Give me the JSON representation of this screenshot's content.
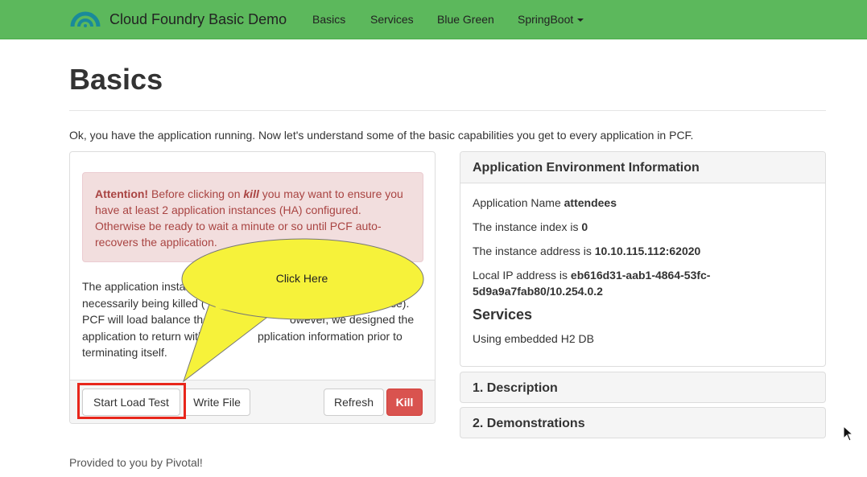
{
  "navbar": {
    "brand": "Cloud Foundry Basic Demo",
    "links": [
      "Basics",
      "Services",
      "Blue Green",
      "SpringBoot"
    ],
    "color": "#5cb85c"
  },
  "page": {
    "title": "Basics",
    "intro": "Ok, you have the application running. Now let's understand some of the basic capabilities you get to every application in PCF."
  },
  "alert": {
    "strong": "Attention!",
    "pre": " Before clicking on ",
    "em": "kill",
    "post": " you may want to ensure you have at least 2 application instances (HA) configured. Otherwise be ready to wait a minute or so until PCF auto-recovers the application."
  },
  "body_text": {
    "line1": "The application insta",
    "line2": "necessarily being killed (",
    "line2b": "se).",
    "line3": "PCF will load balance the reque",
    "line3b": "owever, we designed the",
    "line4": "application to return with the",
    "line4b": "pplication information prior to",
    "line5": "terminating itself."
  },
  "buttons": {
    "start_load": "Start Load Test",
    "write_file": "Write File",
    "refresh": "Refresh",
    "kill": "Kill"
  },
  "callout": {
    "text": "Click Here"
  },
  "env": {
    "heading": "Application Environment Information",
    "app_name_label": "Application Name ",
    "app_name": "attendees",
    "index_label": "The instance index is ",
    "index": "0",
    "address_label": "The instance address is ",
    "address": "10.10.115.112:62020",
    "local_ip_label": "Local IP address is ",
    "local_ip_1": "eb616d31-aab1-4864-53fc-",
    "local_ip_2": "5d9a9a7fab80/10.254.0.2",
    "services_title": "Services",
    "services_text": "Using embedded H2 DB"
  },
  "accordion": [
    "1. Description",
    "2. Demonstrations"
  ],
  "footer": "Provided to you by Pivotal!"
}
